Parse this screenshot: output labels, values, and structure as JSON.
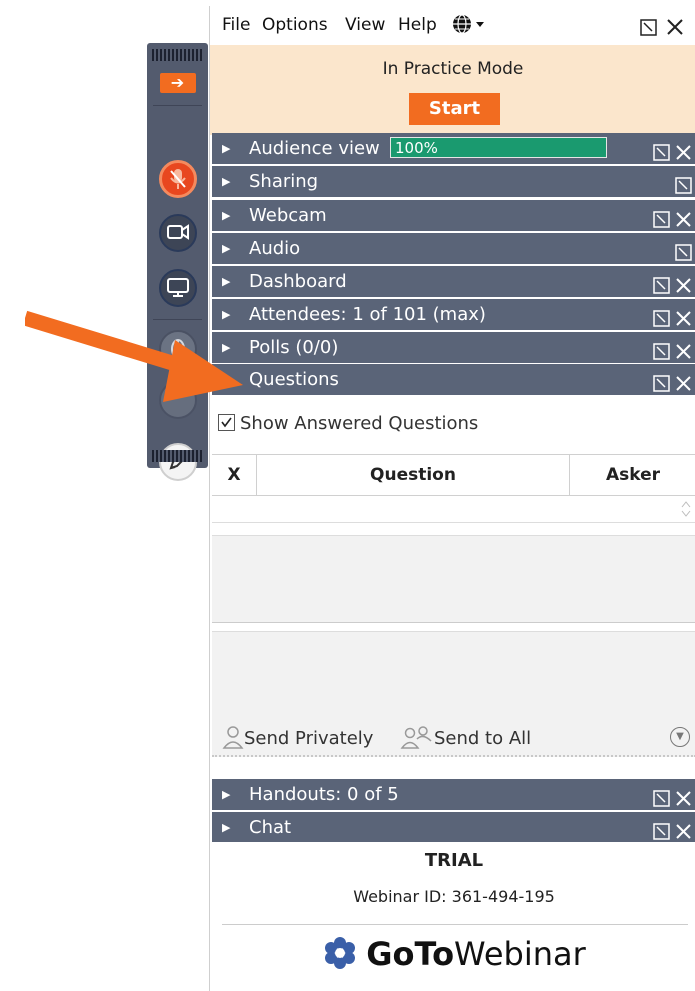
{
  "menu": {
    "file": "File",
    "options": "Options",
    "view": "View",
    "help": "Help"
  },
  "practice": {
    "mode_text": "In Practice Mode",
    "start_label": "Start"
  },
  "panes": [
    {
      "label": "Audience view",
      "close": true
    },
    {
      "label": "Sharing",
      "close": false
    },
    {
      "label": "Webcam",
      "close": true
    },
    {
      "label": "Audio",
      "close": false
    },
    {
      "label": "Dashboard",
      "close": true
    },
    {
      "label": "Attendees:  1 of 101 (max)",
      "close": true
    },
    {
      "label": "Polls (0/0)",
      "close": true
    },
    {
      "label": "Questions",
      "close": true
    }
  ],
  "audience_level": {
    "text": "100%",
    "percent": 100
  },
  "questions": {
    "show_answered": "Show Answered Questions",
    "col_x": "X",
    "col_question": "Question",
    "col_asker": "Asker",
    "send_privately": "Send Privately",
    "send_to_all": "Send to All"
  },
  "bottom_panes": [
    {
      "label": "Handouts: 0 of 5"
    },
    {
      "label": "Chat"
    }
  ],
  "footer": {
    "trial": "TRIAL",
    "webinar_id": "Webinar ID: 361-494-195",
    "brand_bold": "GoTo",
    "brand_light": "Webinar"
  },
  "colors": {
    "accent_orange": "#f26c20",
    "pane_header": "#5a6478",
    "practice_bg": "#fbe6cc",
    "level_green": "#1a9a6f"
  }
}
